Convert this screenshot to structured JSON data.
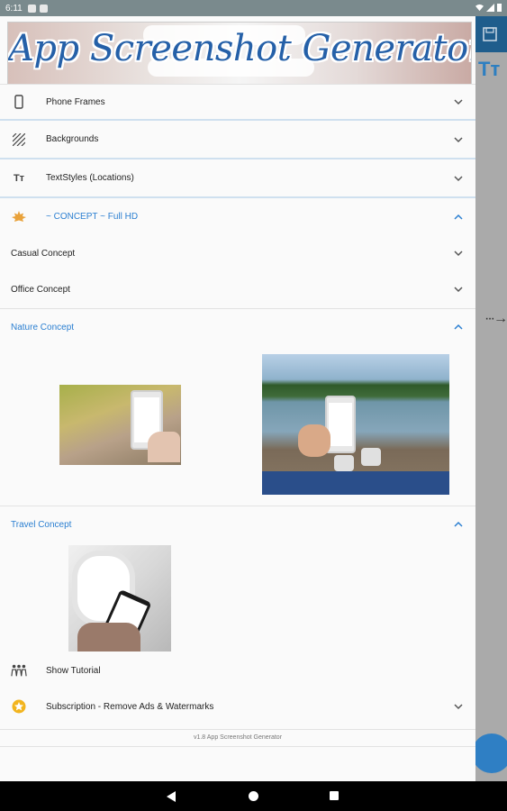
{
  "status_bar": {
    "time": "6:11"
  },
  "banner": {
    "title": "App Screenshot Generator"
  },
  "menu": {
    "phone_frames": "Phone Frames",
    "backgrounds": "Backgrounds",
    "text_styles": "TextStyles (Locations)",
    "concept_header": "~ CONCEPT ~ Full HD",
    "casual": "Casual Concept",
    "office": "Office Concept",
    "nature": "Nature Concept",
    "travel": "Travel Concept",
    "tutorial": "Show Tutorial",
    "subscription": "Subscription - Remove Ads & Watermarks"
  },
  "footer": {
    "version": "v1.8 App Screenshot Generator"
  },
  "background_app": {
    "tt_icon": "Tт"
  },
  "colors": {
    "accent": "#2b7fd1",
    "toolbar": "#1f5d8c",
    "drawer": "#fafafa"
  }
}
